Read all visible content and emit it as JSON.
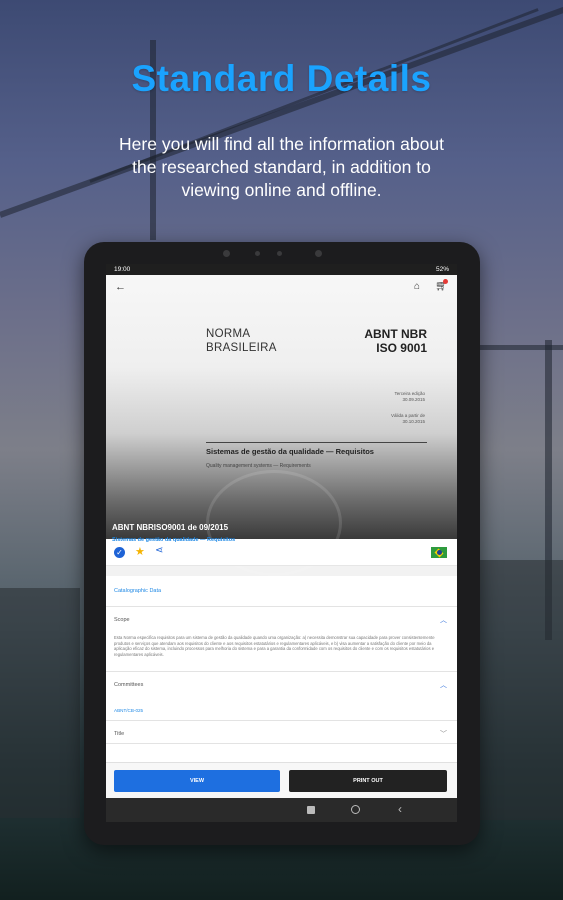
{
  "headline": "Standard Details",
  "subtitle": "Here you will find all the information about the researched standard, in addition to viewing online and offline.",
  "status_bar": {
    "time": "19:00",
    "battery": "52%"
  },
  "icons": {
    "back": "arrow-left-icon",
    "home": "home-icon",
    "cart": "cart-icon",
    "verified": "check-circle-icon",
    "favorite": "star-icon",
    "share": "share-icon",
    "flag": "brazil-flag-icon"
  },
  "document_preview": {
    "norma": "NORMA BRASILEIRA",
    "code": "ABNT NBR ISO 9001",
    "edition_label": "Terceira edição",
    "edition_date": "30.09.2015",
    "validity_label": "Válida a partir de",
    "validity_date": "30.10.2015",
    "title": "Sistemas de gestão da qualidade — Requisitos",
    "subtitle": "Quality management systems — Requirements"
  },
  "standard": {
    "code": "ABNT NBRISO9001 de 09/2015",
    "title_link": "Sistemas de gestão da qualidade — Requisitos"
  },
  "sections": {
    "catalog": "Catalographic Data",
    "scope": {
      "label": "Scope",
      "text": "Esta Norma especifica requisitos para um sistema de gestão da qualidade quando uma organização: a) necessita demonstrar sua capacidade para prover consistentemente produtos e serviços que atendam aos requisitos do cliente e aos requisitos estatutários e regulamentares aplicáveis, e b) visa aumentar a satisfação do cliente por meio da aplicação eficaz do sistema, incluindo processos para melhoria do sistema e para a garantia da conformidade com os requisitos do cliente e com os requisitos estatutários e regulamentares aplicáveis."
    },
    "committees": {
      "label": "Committees",
      "link": "ABNT/CB-025"
    },
    "title": {
      "label": "Title"
    }
  },
  "buttons": {
    "view": "VIEW",
    "print": "PRINT OUT"
  },
  "colors": {
    "accent": "#1aa3ff",
    "primary_button": "#1e6fe0",
    "dark_button": "#222222"
  }
}
